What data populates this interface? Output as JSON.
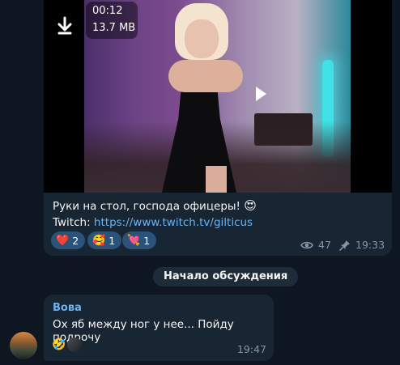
{
  "post": {
    "video": {
      "duration": "00:12",
      "size": "13.7 MB",
      "download_icon": "download-arrow-icon",
      "play_icon": "play-icon"
    },
    "caption_line1": "Руки на стол, господа офицеры!",
    "caption_emoji": "😍",
    "caption_prefix": "Twitch: ",
    "caption_link": "https://www.twitch.tv/gilticus",
    "reactions": [
      {
        "emoji": "❤️",
        "count": "2"
      },
      {
        "emoji": "🥰",
        "count": "1"
      },
      {
        "emoji": "💘",
        "count": "1"
      }
    ],
    "views": "47",
    "time": "19:33",
    "views_icon": "eye-icon",
    "pin_icon": "pin-icon"
  },
  "discussion_label": "Начало обсуждения",
  "reply": {
    "author": "Вова",
    "text": "Ох яб между ног у нее... Пойду подрочу",
    "reaction_emoji": "🤣",
    "time": "19:47"
  },
  "colors": {
    "background": "#0e1621",
    "bubble": "#182533",
    "accent": "#6ab3f3",
    "reaction_bg": "#2b5278",
    "meta": "#8596a8"
  }
}
